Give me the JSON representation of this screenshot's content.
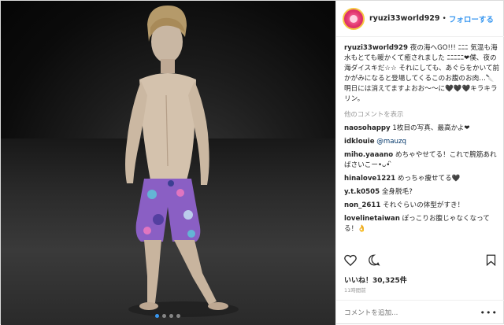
{
  "header": {
    "username": "ryuzi33world929",
    "separator": "•",
    "follow_label": "フォローする"
  },
  "caption": {
    "username": "ryuzi33world929",
    "text": "夜の海へGO!!! ﾆﾆﾆ 気温も海水もとても暖かくて癒されました ﾆﾆﾆﾆﾆ❤僕、夜の海ダイスキだ☆☆ それにしても、あぐらをかいて前かがみになると登場してくるこのお腹のお肉…🔪明日には消えてますよおお〜〜に🖤🖤🖤キラキラリン。"
  },
  "more_comments_label": "他のコメントを表示",
  "comments": [
    {
      "username": "naosohappy",
      "text": "1枚目の写真、最高かよ❤"
    },
    {
      "username": "idklouie",
      "text": "@mauzq"
    },
    {
      "username": "miho.yaaano",
      "text": "めちゃやせてる！これで腕筋あればさいこー•ᴗ•́ ̀"
    },
    {
      "username": "hinalove1221",
      "text": "めっちゃ痩せてる🖤"
    },
    {
      "username": "y.t.k0505",
      "text": "全身脱毛?"
    },
    {
      "username": "non_2611",
      "text": "それぐらいの体型がすき！"
    },
    {
      "username": "lovelinetaiwan",
      "text": "ぽっこりお腹じゃなくなってる！👌"
    }
  ],
  "likes_text": "いいね！30,325件",
  "timestamp": "11時間前",
  "comment_input": {
    "placeholder": "コメントを追加..."
  },
  "menu_label": "•••",
  "carousel": {
    "count": 4,
    "active": 0
  },
  "colors": {
    "accent": "#3897f0",
    "text": "#262626",
    "muted": "#999999"
  }
}
